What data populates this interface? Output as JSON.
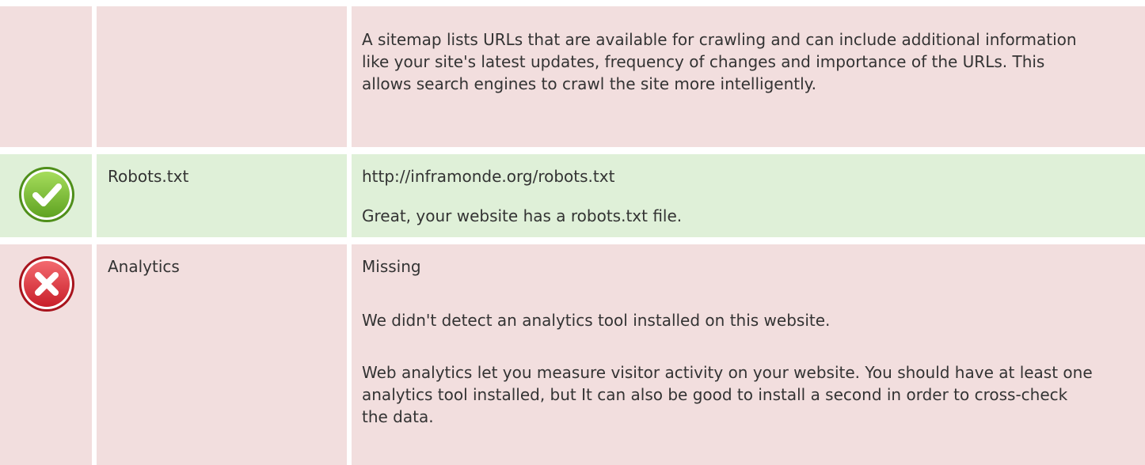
{
  "rows": [
    {
      "id": "sitemap",
      "status": "fail",
      "name": "",
      "detail_paragraphs": [
        "A sitemap lists URLs that are available for crawling and can include additional information like your site's latest updates, frequency of changes and importance of the URLs. This allows search engines to crawl the site more intelligently."
      ]
    },
    {
      "id": "robots",
      "status": "pass",
      "icon": "check-circle-icon",
      "name": "Robots.txt",
      "value": "http://inframonde.org/robots.txt",
      "detail_paragraphs": [
        "Great, your website has a robots.txt file."
      ]
    },
    {
      "id": "analytics",
      "status": "fail",
      "icon": "error-cross-icon",
      "name": "Analytics",
      "value": "Missing",
      "detail_paragraphs": [
        "We didn't detect an analytics tool installed on this website.",
        "Web analytics let you measure visitor activity on your website. You should have at least one analytics tool installed, but It can also be good to install a second in order to cross-check the data."
      ]
    }
  ],
  "colors": {
    "fail_bg": "#f2dede",
    "pass_bg": "#dff0d8",
    "pass_icon": "#7cc33a",
    "fail_icon": "#e0303a",
    "text": "#333333"
  }
}
